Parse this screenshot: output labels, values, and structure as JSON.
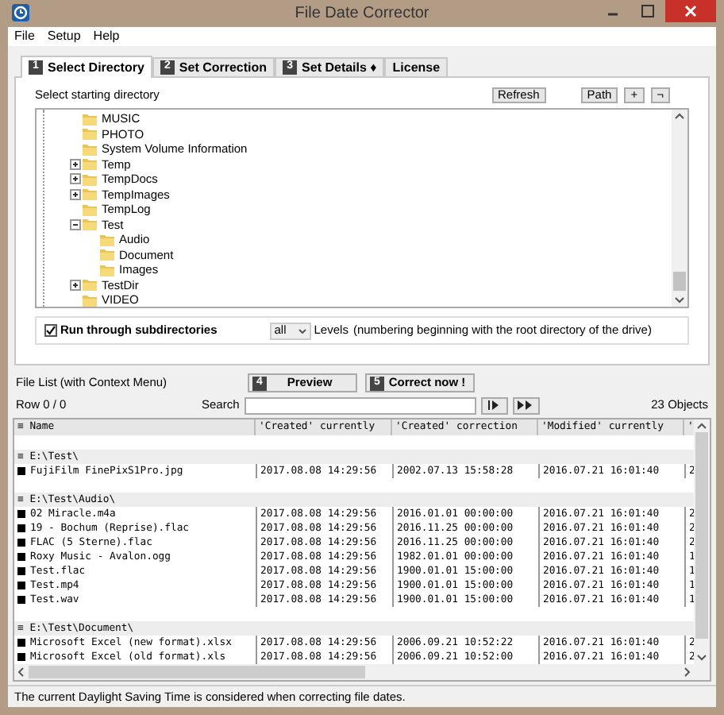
{
  "window": {
    "title": "File Date Corrector"
  },
  "menu": [
    "File",
    "Setup",
    "Help"
  ],
  "tabs": [
    {
      "number": "1",
      "label": "Select Directory",
      "selected": true
    },
    {
      "number": "2",
      "label": "Set Correction",
      "selected": false
    },
    {
      "number": "3",
      "label": "Set Details ♦",
      "selected": false
    },
    {
      "label": "License",
      "selected": false
    }
  ],
  "directory": {
    "label": "Select starting directory",
    "buttons": [
      "Refresh",
      "Path",
      "+",
      "¬"
    ],
    "tree": [
      {
        "name": "MUSIC"
      },
      {
        "name": "PHOTO"
      },
      {
        "name": "System Volume Information"
      },
      {
        "name": "Temp",
        "expanded": false
      },
      {
        "name": "TempDocs",
        "expanded": false
      },
      {
        "name": "TempImages",
        "expanded": false
      },
      {
        "name": "TempLog"
      },
      {
        "name": "Test",
        "expanded": true,
        "children": [
          {
            "name": "Audio"
          },
          {
            "name": "Document"
          },
          {
            "name": "Images"
          }
        ]
      },
      {
        "name": "TestDir",
        "expanded": false
      },
      {
        "name": "VIDEO"
      }
    ]
  },
  "options": {
    "checkbox": {
      "label": "Run through subdirectories",
      "checked": true
    },
    "levels_value": "all",
    "levels_label": "Levels",
    "note": "(numbering beginning with the root directory of the drive)"
  },
  "file_list": {
    "label": "File List (with Context Menu)",
    "actions": [
      {
        "number": "4",
        "label": "Preview"
      },
      {
        "number": "5",
        "label": "Correct now !"
      }
    ],
    "row_info": "Row 0 / 0",
    "search_label": "Search",
    "count": "23 Objects",
    "columns": [
      "≡ Name",
      "'Created' currently",
      "'Created' correction",
      "'Modified' currently",
      "'"
    ],
    "rows": [
      {
        "kind": "blank"
      },
      {
        "kind": "group",
        "name": "≡ E:\\Test\\"
      },
      {
        "kind": "file",
        "cells": [
          "FujiFilm FinePixS1Pro.jpg",
          "2017.08.08 14:29:56",
          "2002.07.13 15:58:28",
          "2016.07.21 16:01:40",
          "2"
        ]
      },
      {
        "kind": "blank"
      },
      {
        "kind": "group",
        "name": "≡ E:\\Test\\Audio\\"
      },
      {
        "kind": "file",
        "cells": [
          "02 Miracle.m4a",
          "2017.08.08 14:29:56",
          "2016.01.01 00:00:00",
          "2016.07.21 16:01:40",
          "2"
        ]
      },
      {
        "kind": "file",
        "cells": [
          "19 - Bochum (Reprise).flac",
          "2017.08.08 14:29:56",
          "2016.11.25 00:00:00",
          "2016.07.21 16:01:40",
          "2"
        ]
      },
      {
        "kind": "file",
        "cells": [
          "FLAC (5 Sterne).flac",
          "2017.08.08 14:29:56",
          "2016.11.25 00:00:00",
          "2016.07.21 16:01:40",
          "2"
        ]
      },
      {
        "kind": "file",
        "cells": [
          "Roxy Music - Avalon.ogg",
          "2017.08.08 14:29:56",
          "1982.01.01 00:00:00",
          "2016.07.21 16:01:40",
          "1"
        ]
      },
      {
        "kind": "file",
        "cells": [
          "Test.flac",
          "2017.08.08 14:29:56",
          "1900.01.01 15:00:00",
          "2016.07.21 16:01:40",
          "1"
        ]
      },
      {
        "kind": "file",
        "cells": [
          "Test.mp4",
          "2017.08.08 14:29:56",
          "1900.01.01 15:00:00",
          "2016.07.21 16:01:40",
          "1"
        ]
      },
      {
        "kind": "file",
        "cells": [
          "Test.wav",
          "2017.08.08 14:29:56",
          "1900.01.01 15:00:00",
          "2016.07.21 16:01:40",
          "1"
        ]
      },
      {
        "kind": "blank"
      },
      {
        "kind": "group",
        "name": "≡ E:\\Test\\Document\\"
      },
      {
        "kind": "file",
        "cells": [
          "Microsoft Excel (new format).xlsx",
          "2017.08.08 14:29:56",
          "2006.09.21 10:52:22",
          "2016.07.21 16:01:40",
          "2"
        ]
      },
      {
        "kind": "file",
        "cells": [
          "Microsoft Excel (old format).xls",
          "2017.08.08 14:29:56",
          "2006.09.21 10:52:00",
          "2016.07.21 16:01:40",
          "2"
        ]
      }
    ]
  },
  "status_bar": "The current Daylight Saving Time is considered when correcting file dates."
}
